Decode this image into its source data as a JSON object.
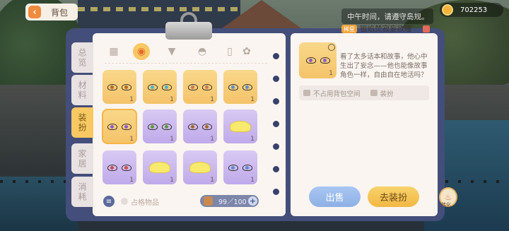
{
  "top_bar": {
    "back_label": "背包",
    "hint": "中午时间，请遵守岛规。",
    "coins": "702253"
  },
  "side_tabs": [
    {
      "label": "总览",
      "active": false
    },
    {
      "label": "材料",
      "active": false
    },
    {
      "label": "装扮",
      "active": true
    },
    {
      "label": "家居",
      "active": false
    },
    {
      "label": "消耗",
      "active": false
    }
  ],
  "categories": [
    {
      "icon": "grid-icon",
      "active": false
    },
    {
      "icon": "makeup-icon",
      "active": true
    },
    {
      "icon": "shirt-icon",
      "active": false
    },
    {
      "icon": "hat-icon",
      "active": false
    },
    {
      "icon": "phone-icon",
      "active": false
    },
    {
      "icon": "settings-icon",
      "active": false
    }
  ],
  "items": [
    {
      "type": "eyes",
      "color": "gold",
      "iris": "#b06a2a",
      "count": "1"
    },
    {
      "type": "eyes",
      "color": "gold",
      "iris": "#4bb3c9",
      "count": "1"
    },
    {
      "type": "eyes",
      "color": "gold",
      "iris": "#c77a5c",
      "count": "1"
    },
    {
      "type": "eyes",
      "color": "gold",
      "iris": "#5a8fd1",
      "count": "1"
    },
    {
      "type": "eyes",
      "color": "gold",
      "iris": "#8c5ad1",
      "count": "1",
      "selected": true
    },
    {
      "type": "eyes",
      "color": "purple",
      "iris": "#5b9a3a",
      "count": "1"
    },
    {
      "type": "eyes",
      "color": "purple",
      "iris": "#a26a2e",
      "count": "1"
    },
    {
      "type": "pudding",
      "color": "purple",
      "count": "1"
    },
    {
      "type": "eyes",
      "color": "purple",
      "iris": "#d04a4a",
      "count": "1"
    },
    {
      "type": "pudding",
      "color": "purple",
      "count": "1"
    },
    {
      "type": "pudding",
      "color": "purple",
      "count": "1"
    },
    {
      "type": "eyes",
      "color": "purple",
      "iris": "#5a8fd1",
      "count": "1"
    }
  ],
  "bottom": {
    "checkbox_label": "占格物品",
    "capacity": "99／100"
  },
  "detail": {
    "rarity": "稀星",
    "name": "银焰焚寂妄欲瞳",
    "count": "1",
    "description": "看了太多话本和故事，他心中生出了妄念——他也能像故事角色一样，自由自在地活吗？",
    "tag1": "不占用背包空间",
    "tag2": "装扮",
    "sell_label": "出售",
    "equip_label": "去装扮",
    "bottle_label": "转化"
  }
}
